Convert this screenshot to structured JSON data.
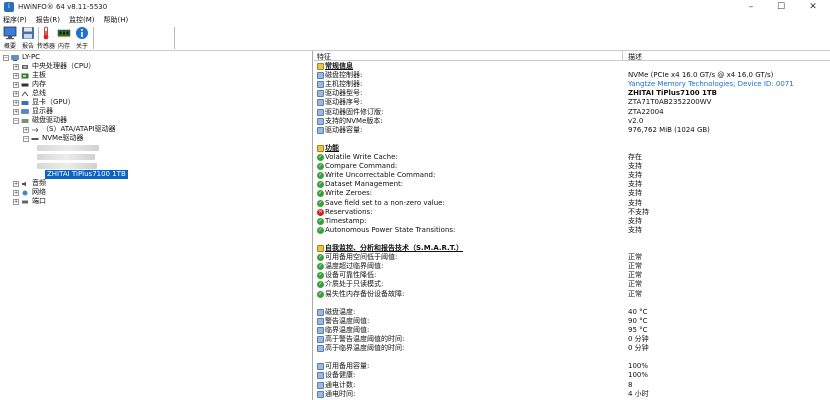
{
  "window": {
    "title": "HWiNFO® 64 v8.11-5530",
    "minimize": "–",
    "maximize": "☐",
    "close": "✕"
  },
  "menu": [
    "程序(P)",
    "报告(R)",
    "监控(M)",
    "帮助(H)"
  ],
  "toolbar": [
    {
      "label": "概要",
      "icon": "monitor-icon"
    },
    {
      "label": "报告",
      "icon": "save-icon"
    },
    {
      "label": "传感器",
      "icon": "thermometer-icon"
    },
    {
      "label": "内存",
      "icon": "memory-icon"
    },
    {
      "label": "关于",
      "icon": "info-icon"
    }
  ],
  "tree": {
    "root": "LY-PC",
    "items": [
      {
        "label": "中央处理器（CPU）"
      },
      {
        "label": "主板"
      },
      {
        "label": "内存"
      },
      {
        "label": "总线"
      },
      {
        "label": "显卡（GPU）"
      },
      {
        "label": "显示器"
      },
      {
        "label": "磁盘驱动器"
      },
      {
        "label": "（S）ATA/ATAPI驱动器"
      },
      {
        "label": "NVMe驱动器"
      },
      {
        "label": "ZHITAI TiPlus7100 1TB"
      },
      {
        "label": "音频"
      },
      {
        "label": "网络"
      },
      {
        "label": "端口"
      }
    ]
  },
  "columns": {
    "feature": "特征",
    "description": "描述"
  },
  "rows": [
    {
      "f": "常规信息",
      "v": "",
      "type": "section"
    },
    {
      "f": "磁盘控制器:",
      "v": "NVMe (PCIe x4 16.0 GT/s @ x4 16.0 GT/s)"
    },
    {
      "f": "主机控制器:",
      "v": "Yangtze Memory Technologies; Device ID: 0071",
      "link": true
    },
    {
      "f": "驱动器型号:",
      "v": "ZHITAI TiPlus7100 1TB",
      "bold": true
    },
    {
      "f": "驱动器序号:",
      "v": "ZTA71T0AB2352200WV"
    },
    {
      "f": "驱动器固件修订版:",
      "v": "ZTA22004"
    },
    {
      "f": "支持的NVMe版本:",
      "v": "v2.0"
    },
    {
      "f": "驱动器容量:",
      "v": "976,762 MiB (1024 GB)"
    },
    {
      "f": "",
      "v": "",
      "type": "blank"
    },
    {
      "f": "功能",
      "v": "",
      "type": "section"
    },
    {
      "f": "Volatile Write Cache:",
      "v": "存在",
      "icon": "ok"
    },
    {
      "f": "Compare Command:",
      "v": "支持",
      "icon": "ok"
    },
    {
      "f": "Write Uncorrectable Command:",
      "v": "支持",
      "icon": "ok"
    },
    {
      "f": "Dataset Management:",
      "v": "支持",
      "icon": "ok"
    },
    {
      "f": "Write Zeroes:",
      "v": "支持",
      "icon": "ok"
    },
    {
      "f": "Save field set to a non-zero value:",
      "v": "支持",
      "icon": "ok"
    },
    {
      "f": "Reservations:",
      "v": "不支持",
      "icon": "bad"
    },
    {
      "f": "Timestamp:",
      "v": "支持",
      "icon": "ok"
    },
    {
      "f": "Autonomous Power State Transitions:",
      "v": "支持",
      "icon": "ok"
    },
    {
      "f": "",
      "v": "",
      "type": "blank"
    },
    {
      "f": "自我监控、分析和报告技术（S.M.A.R.T.）",
      "v": "",
      "type": "section"
    },
    {
      "f": "可用备用空间低于阈值:",
      "v": "正常",
      "icon": "ok"
    },
    {
      "f": "温度超过临界阈值:",
      "v": "正常",
      "icon": "ok"
    },
    {
      "f": "设备可靠性降低:",
      "v": "正常",
      "icon": "ok"
    },
    {
      "f": "介质处于只读模式:",
      "v": "正常",
      "icon": "ok"
    },
    {
      "f": "易失性内存备份设备故障:",
      "v": "正常",
      "icon": "ok"
    },
    {
      "f": "",
      "v": "",
      "type": "blank"
    },
    {
      "f": "磁盘温度:",
      "v": "40 °C"
    },
    {
      "f": "警告温度阈值:",
      "v": "90 °C"
    },
    {
      "f": "临界温度阈值:",
      "v": "95 °C"
    },
    {
      "f": "高于警告温度阈值的时间:",
      "v": "0 分钟"
    },
    {
      "f": "高于临界温度阈值的时间:",
      "v": "0 分钟"
    },
    {
      "f": "",
      "v": "",
      "type": "blank"
    },
    {
      "f": "可用备用容量:",
      "v": "100%"
    },
    {
      "f": "设备健康:",
      "v": "100%"
    },
    {
      "f": "通电计数:",
      "v": "8"
    },
    {
      "f": "通电时间:",
      "v": "4 小时"
    }
  ]
}
